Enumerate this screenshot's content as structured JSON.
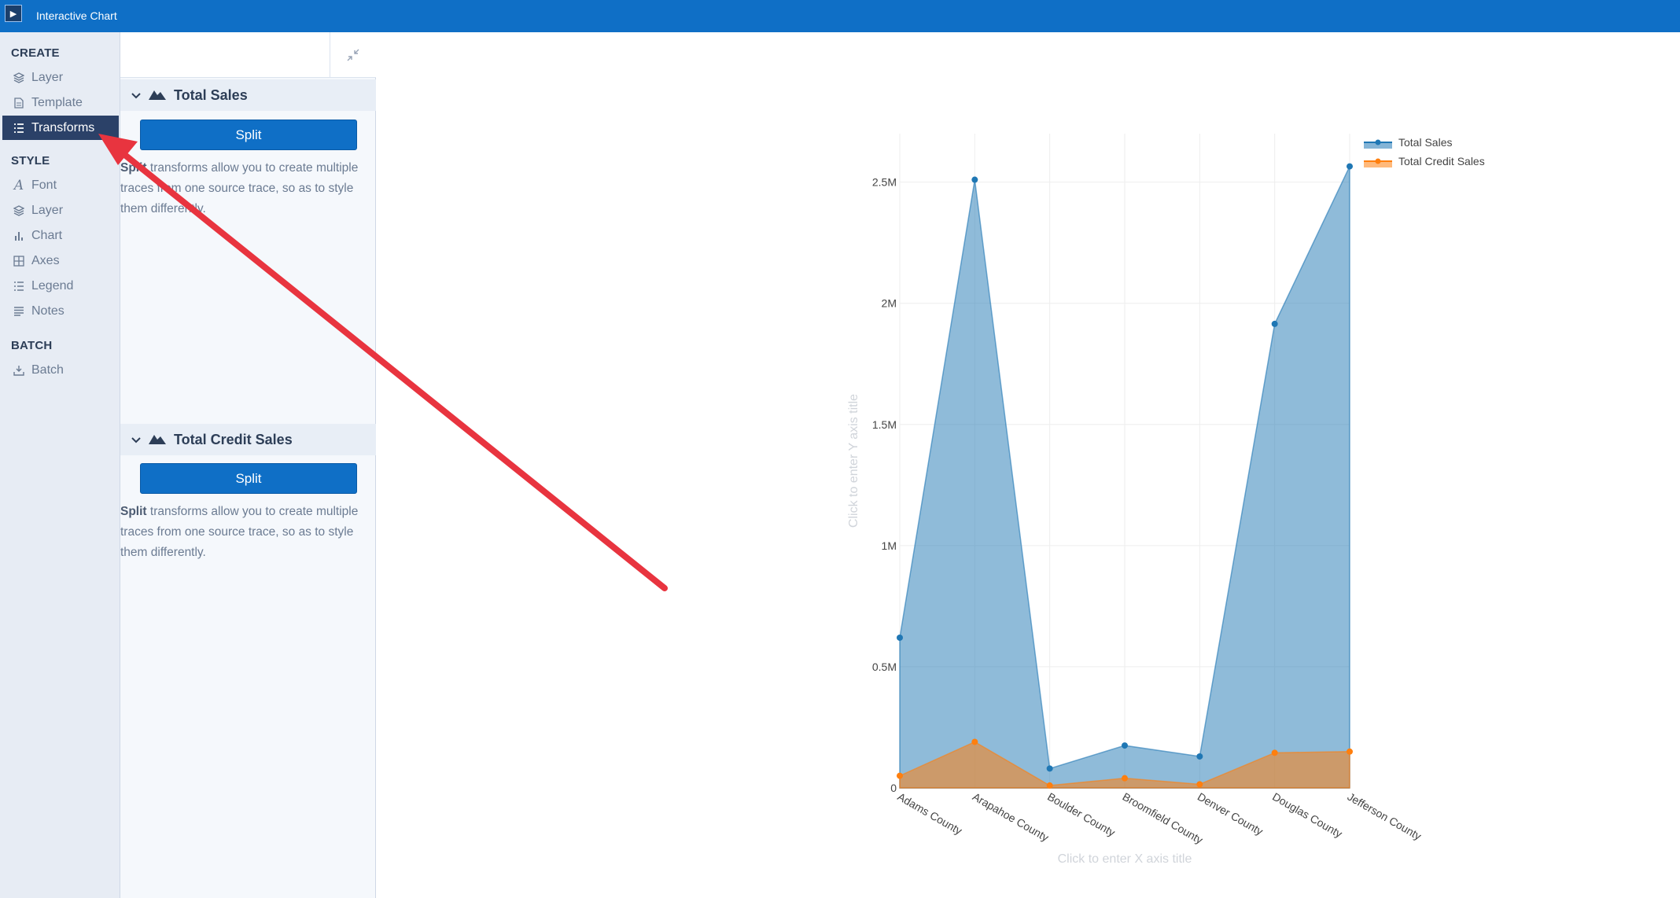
{
  "window": {
    "title": "Interactive Chart",
    "app_icon": "play-icon"
  },
  "nav": {
    "groups": [
      {
        "label": "CREATE",
        "items": [
          {
            "label": "Layer",
            "icon": "layers-icon"
          },
          {
            "label": "Template",
            "icon": "document-icon"
          },
          {
            "label": "Transforms",
            "icon": "list-icon",
            "active": true
          }
        ]
      },
      {
        "label": "STYLE",
        "items": [
          {
            "label": "Font",
            "icon": "font-icon"
          },
          {
            "label": "Layer",
            "icon": "layers-icon"
          },
          {
            "label": "Chart",
            "icon": "bar-chart-icon"
          },
          {
            "label": "Axes",
            "icon": "grid-icon"
          },
          {
            "label": "Legend",
            "icon": "list-icon"
          },
          {
            "label": "Notes",
            "icon": "notes-icon"
          }
        ]
      },
      {
        "label": "BATCH",
        "items": [
          {
            "label": "Batch",
            "icon": "batch-icon"
          }
        ]
      }
    ]
  },
  "panel": {
    "sections": [
      {
        "title": "Total Sales",
        "button": "Split",
        "desc_bold": "Split",
        "desc_rest": " transforms allow you to create multiple traces from one source trace, so as to style them differently."
      },
      {
        "title": "Total Credit Sales",
        "button": "Split",
        "desc_bold": "Split",
        "desc_rest": " transforms allow you to create multiple traces from one source trace, so as to style them differently."
      }
    ]
  },
  "chart_data": {
    "type": "area",
    "categories": [
      "Adams County",
      "Arapahoe County",
      "Boulder County",
      "Broomfield County",
      "Denver County",
      "Douglas County",
      "Jefferson County"
    ],
    "series": [
      {
        "name": "Total Sales",
        "values": [
          620000,
          2510000,
          80000,
          175000,
          130000,
          1915000,
          2565000
        ],
        "color": "#1f77b4"
      },
      {
        "name": "Total Credit Sales",
        "values": [
          50000,
          190000,
          10000,
          40000,
          15000,
          145000,
          150000
        ],
        "color": "#ff7f0e"
      }
    ],
    "yticks": [
      "0",
      "0.5M",
      "1M",
      "1.5M",
      "2M",
      "2.5M"
    ],
    "ylim": [
      0,
      2700000
    ],
    "xlabel_placeholder": "Click to enter X axis title",
    "ylabel_placeholder": "Click to enter Y axis title",
    "legend_position": "top-right",
    "grid": true
  }
}
